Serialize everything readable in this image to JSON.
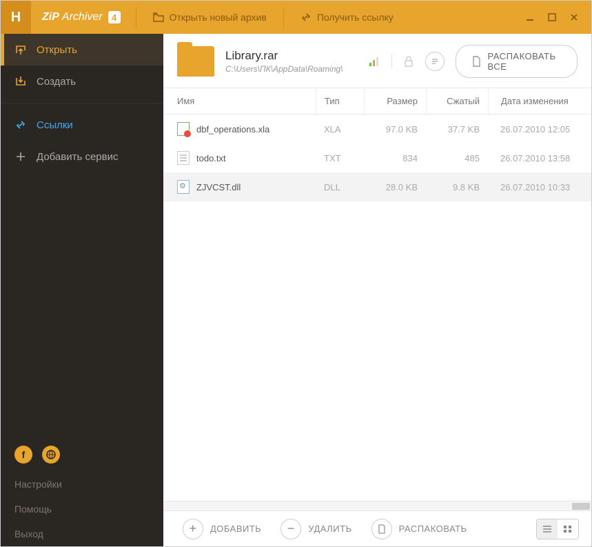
{
  "titlebar": {
    "app_name_zip": "ZiP",
    "app_name_arch": "Archiver",
    "app_name_ver": "4",
    "open_new_archive": "Открыть новый архив",
    "get_link": "Получить ссылку"
  },
  "sidebar": {
    "open": "Открыть",
    "create": "Создать",
    "links": "Ссылки",
    "add_service": "Добавить сервис",
    "settings": "Настройки",
    "help": "Помощь",
    "exit": "Выход"
  },
  "archive": {
    "name": "Library.rar",
    "path": "C:\\Users\\ПК\\AppData\\Roaming\\",
    "extract_all": "РАСПАКОВАТЬ ВСЕ"
  },
  "columns": {
    "name": "Имя",
    "type": "Тип",
    "size": "Размер",
    "packed": "Сжатый",
    "date": "Дата изменения"
  },
  "files": [
    {
      "name": "dbf_operations.xla",
      "type": "XLA",
      "size": "97.0 KB",
      "packed": "37.7 KB",
      "date": "26.07.2010 12:05",
      "icon": "xla"
    },
    {
      "name": "todo.txt",
      "type": "TXT",
      "size": "834",
      "packed": "485",
      "date": "26.07.2010 13:58",
      "icon": "txt"
    },
    {
      "name": "ZJVCST.dll",
      "type": "DLL",
      "size": "28.0 KB",
      "packed": "9.8 KB",
      "date": "26.07.2010 10:33",
      "icon": "dll",
      "selected": true
    }
  ],
  "bottom": {
    "add": "ДОБАВИТЬ",
    "delete": "УДАЛИТЬ",
    "extract": "РАСПАКОВАТЬ"
  }
}
